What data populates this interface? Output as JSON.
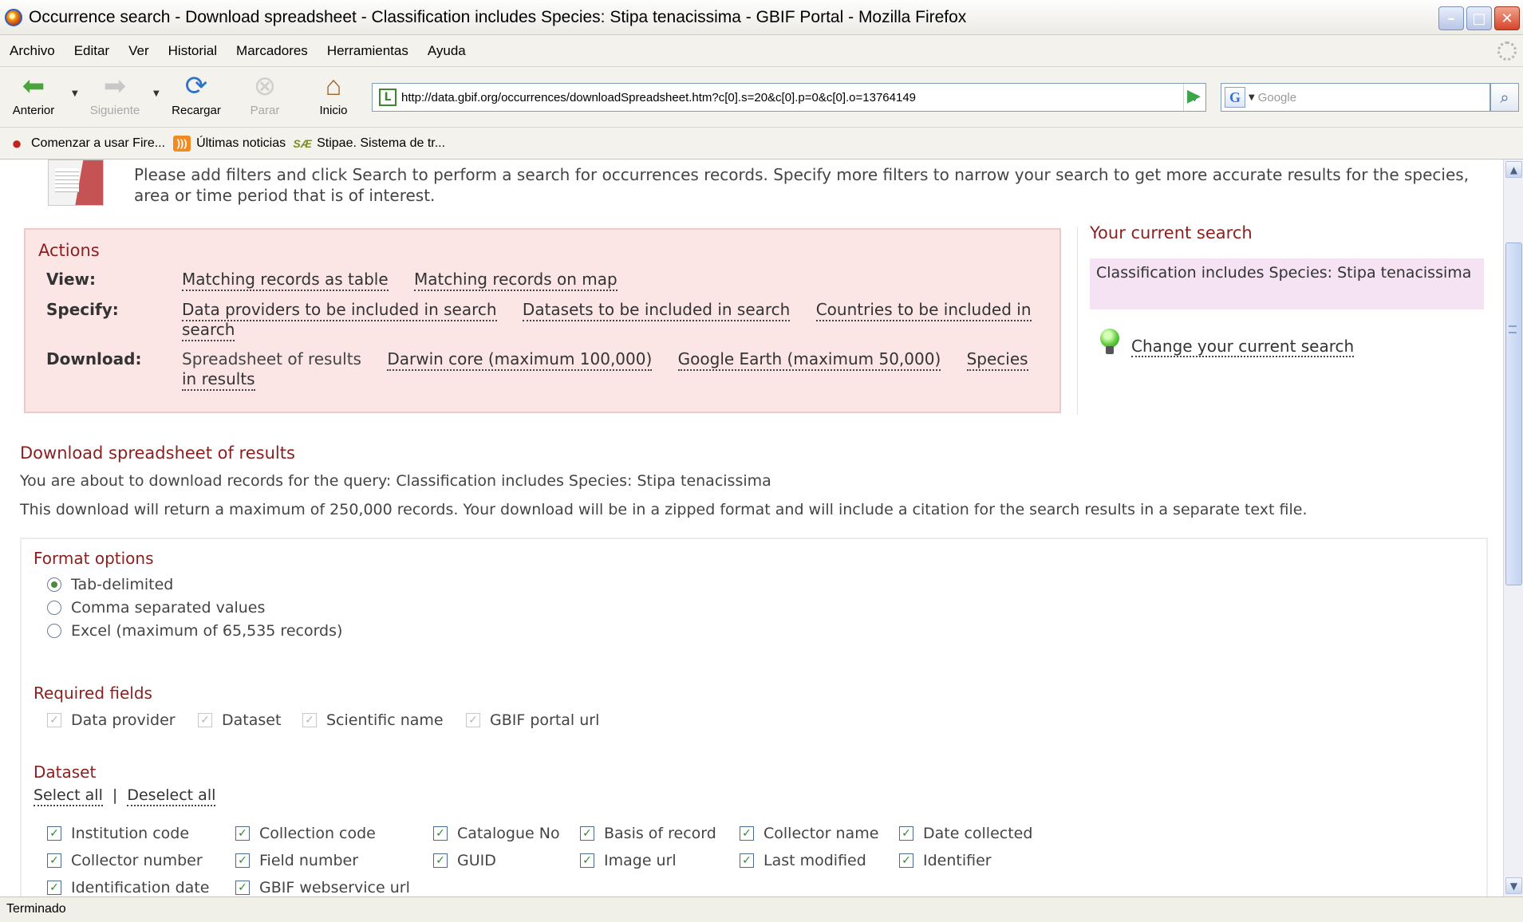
{
  "window": {
    "title": "Occurrence search - Download spreadsheet - Classification includes Species: Stipa tenacissima - GBIF Portal - Mozilla Firefox"
  },
  "menu": [
    "Archivo",
    "Editar",
    "Ver",
    "Historial",
    "Marcadores",
    "Herramientas",
    "Ayuda"
  ],
  "nav": {
    "back": "Anterior",
    "forward": "Siguiente",
    "reload": "Recargar",
    "stop": "Parar",
    "home": "Inicio"
  },
  "url": "http://data.gbif.org/occurrences/downloadSpreadsheet.htm?c[0].s=20&c[0].p=0&c[0].o=13764149",
  "search_placeholder": "Google",
  "bookmarks": [
    "Comenzar a usar Fire...",
    "Últimas noticias",
    "Stipae. Sistema de tr..."
  ],
  "intro": "Please add filters and click Search to perform a search for occurrences records. Specify more filters to narrow your search to get more accurate results for the species, area or time period that is of interest.",
  "actions": {
    "title": "Actions",
    "view_label": "View:",
    "view_links": [
      "Matching records as table",
      "Matching records on map"
    ],
    "specify_label": "Specify:",
    "specify_links": [
      "Data providers to be included in search",
      "Datasets to be included in search",
      "Countries to be included in search"
    ],
    "download_label": "Download:",
    "download_current": "Spreadsheet of results",
    "download_links": [
      "Darwin core (maximum 100,000)",
      "Google Earth (maximum 50,000)",
      "Species in results"
    ]
  },
  "current_search": {
    "title": "Your current search",
    "text": "Classification includes Species: Stipa tenacissima",
    "change_link": "Change your current search"
  },
  "download": {
    "title": "Download spreadsheet of results",
    "query_line": "You are about to download records for the query: Classification includes Species: Stipa tenacissima",
    "info_line": "This download will return a maximum of 250,000 records. Your download will be in a zipped format and will include a citation for the search results in a separate text file."
  },
  "format": {
    "title": "Format options",
    "options": [
      "Tab-delimited",
      "Comma separated values",
      "Excel (maximum of 65,535 records)"
    ],
    "selected": "Tab-delimited"
  },
  "required": {
    "title": "Required fields",
    "fields": [
      "Data provider",
      "Dataset",
      "Scientific name",
      "GBIF portal url"
    ]
  },
  "dataset": {
    "title": "Dataset",
    "select_all": "Select all",
    "separator": "|",
    "deselect_all": "Deselect all",
    "fields": [
      "Institution code",
      "Collection code",
      "Catalogue No",
      "Basis of record",
      "Collector name",
      "Date collected",
      "Collector number",
      "Field number",
      "GUID",
      "Image url",
      "Last modified",
      "Identifier",
      "Identification date",
      "GBIF webservice url"
    ]
  },
  "status": "Terminado"
}
